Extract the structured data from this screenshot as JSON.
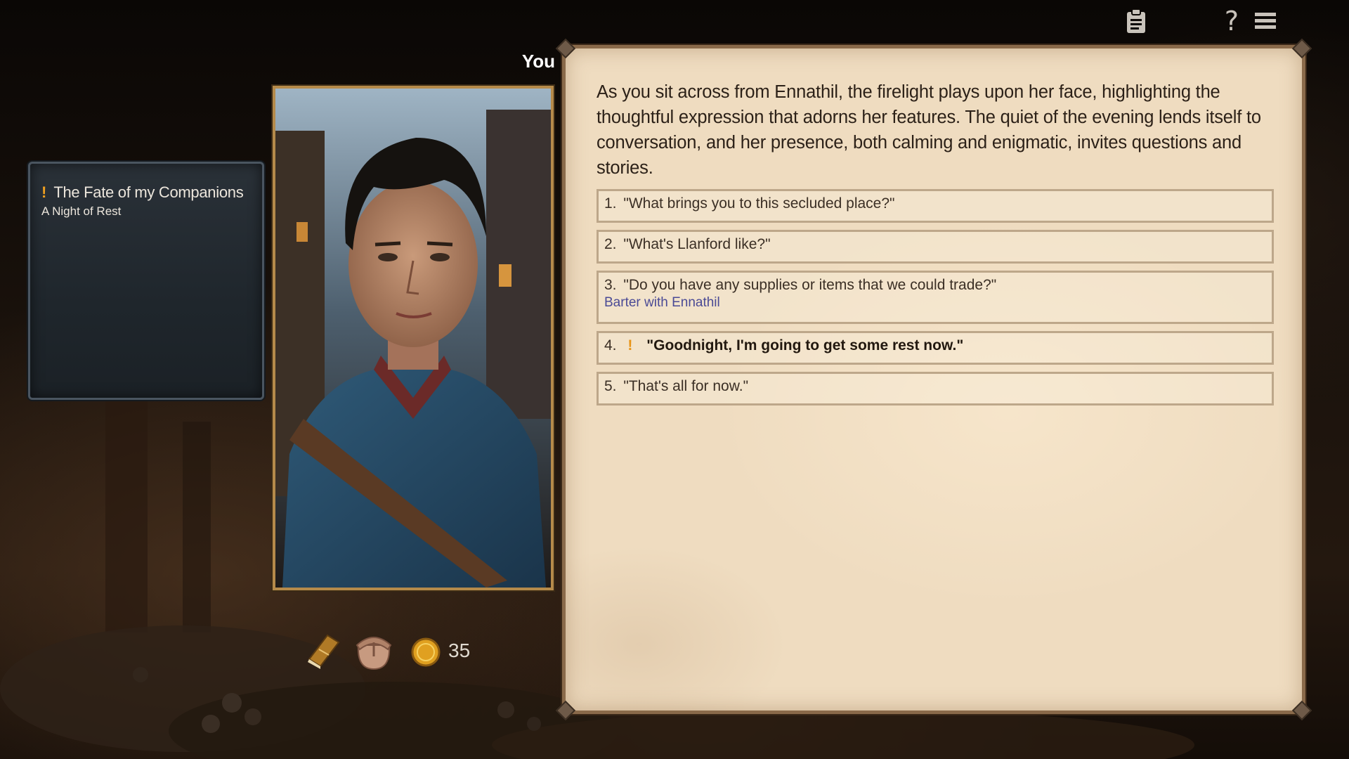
{
  "top_bar": {
    "journal_icon": "clipboard-icon",
    "help_label": "?",
    "menu_icon": "hamburger-menu-icon"
  },
  "quest": {
    "marker": "!",
    "title": "The Fate of my Companions",
    "subtitle": "A Night of Rest"
  },
  "player": {
    "label": "You",
    "portrait": "player-portrait"
  },
  "inventory": {
    "book_icon": "journal-book-icon",
    "bag_icon": "satchel-icon",
    "coin_icon": "gold-coin-icon",
    "gold": "35"
  },
  "dialogue": {
    "narration": "As you sit across from Ennathil, the firelight plays upon her face, highlighting the thoughtful expression that adorns her features. The quiet of the evening lends itself to conversation, and her presence, both calming and enigmatic, invites questions and stories.",
    "options": [
      {
        "num": "1.",
        "text": "\"What brings you to this secluded place?\""
      },
      {
        "num": "2.",
        "text": "\"What's Llanford like?\""
      },
      {
        "num": "3.",
        "text": "\"Do you have any supplies or items that we could trade?\"",
        "sub": "Barter with Ennathil"
      },
      {
        "num": "4.",
        "marker": "!",
        "text": "\"Goodnight, I'm going to get some rest now.\""
      },
      {
        "num": "5.",
        "text": "\"That's all for now.\""
      }
    ]
  },
  "colors": {
    "parchment": "#efdcc0",
    "frame_gold": "#b58a4a",
    "quest_marker": "#f0a020",
    "barter_link": "#4a4a95"
  }
}
